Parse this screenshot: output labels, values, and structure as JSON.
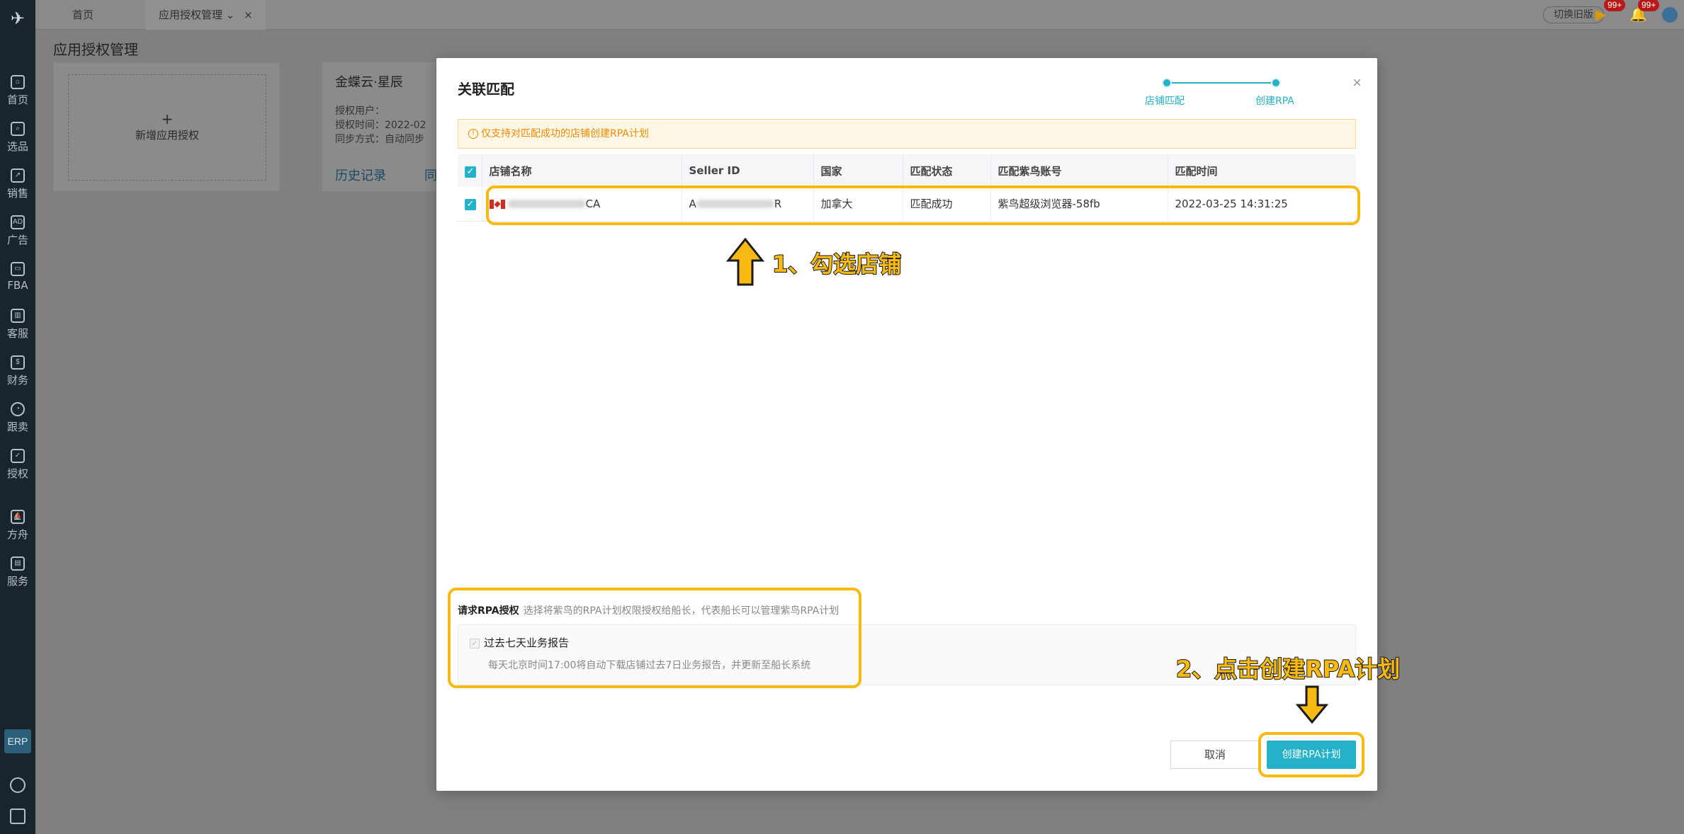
{
  "sidebar": {
    "items": [
      {
        "label": "首页",
        "icon": "home-icon"
      },
      {
        "label": "选品",
        "icon": "search-icon"
      },
      {
        "label": "销售",
        "icon": "chart-icon"
      },
      {
        "label": "广告",
        "icon": "ad-icon"
      },
      {
        "label": "FBA",
        "icon": "box-icon"
      },
      {
        "label": "客服",
        "icon": "support-icon"
      },
      {
        "label": "财务",
        "icon": "finance-icon"
      },
      {
        "label": "跟卖",
        "icon": "pie-icon"
      },
      {
        "label": "授权",
        "icon": "shield-icon"
      },
      {
        "label": "方舟",
        "icon": "ark-icon"
      },
      {
        "label": "服务",
        "icon": "service-icon"
      }
    ],
    "erp": "ERP"
  },
  "topbar": {
    "tab_home": "首页",
    "tab_active": "应用授权管理",
    "old_version": "切换旧版",
    "badge1": "99+",
    "badge2": "99+"
  },
  "page": {
    "title": "应用授权管理",
    "add_app": "新增应用授权",
    "card_title": "金蝶云·星辰",
    "row1": "授权用户：",
    "row2": "授权时间：",
    "row2_val": "2022-02",
    "row3": "同步方式：",
    "row3_val": "自动同步",
    "history": "历史记录",
    "sync": "同"
  },
  "modal": {
    "title": "关联匹配",
    "steps": [
      "店铺匹配",
      "创建RPA"
    ],
    "notice": "仅支持对匹配成功的店铺创建RPA计划",
    "columns": [
      "店铺名称",
      "Seller ID",
      "国家",
      "匹配状态",
      "匹配紫鸟账号",
      "匹配时间"
    ],
    "rows": [
      {
        "shop_suffix": "CA",
        "seller_prefix": "A",
        "seller_suffix": "R",
        "country": "加拿大",
        "status": "匹配成功",
        "account": "紫鸟超级浏览器-58fb",
        "time": "2022-03-25 14:31:25"
      }
    ],
    "rpa_title": "请求RPA授权",
    "rpa_desc": "选择将紫鸟的RPA计划权限授权给船长，代表船长可以管理紫鸟RPA计划",
    "rpa_option": "过去七天业务报告",
    "rpa_option_desc": "每天北京时间17:00将自动下载店铺过去7日业务报告，并更新至船长系统",
    "cancel": "取消",
    "create": "创建RPA计划"
  },
  "annotations": {
    "step1": "1、勾选店铺",
    "step2": "2、点击创建RPA计划"
  },
  "colors": {
    "accent": "#25b2c9",
    "highlight": "#f8b912",
    "success": "#52c41a",
    "warning": "#f08a00"
  }
}
